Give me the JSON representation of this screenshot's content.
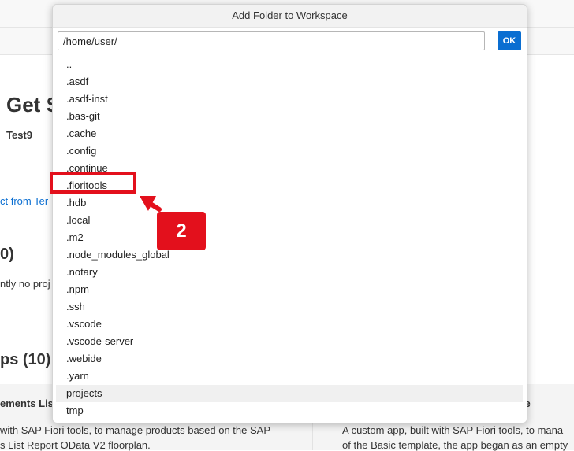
{
  "background": {
    "page_title": "Get S",
    "tab_active": "Test9",
    "link_text": "ct from Ter",
    "section1_heading": "0)",
    "section1_text": "ntly no proj",
    "section2_heading": "ps (10)",
    "card1": {
      "title": "ements List",
      "desc_line1": "with SAP Fiori tools, to manage products based on the SAP",
      "desc_line2": "s List Report OData V2 floorplan."
    },
    "card2": {
      "title": "ate",
      "desc_line1": "A custom app, built with SAP Fiori tools, to mana",
      "desc_line2": "of the Basic template, the app began as an empty"
    }
  },
  "dialog": {
    "title": "Add Folder to Workspace",
    "path_value": "/home/user/",
    "ok_label": "OK",
    "folders": [
      "..",
      ".asdf",
      ".asdf-inst",
      ".bas-git",
      ".cache",
      ".config",
      ".continue",
      ".fioritools",
      ".hdb",
      ".local",
      ".m2",
      ".node_modules_global",
      ".notary",
      ".npm",
      ".ssh",
      ".vscode",
      ".vscode-server",
      ".webide",
      ".yarn",
      "projects",
      "tmp"
    ],
    "hovered_folder": "projects",
    "highlighted_folder": ".fioritools"
  },
  "annotation": {
    "step_number": "2",
    "color": "#e3101c"
  },
  "colors": {
    "accent": "#0a6ed1"
  }
}
